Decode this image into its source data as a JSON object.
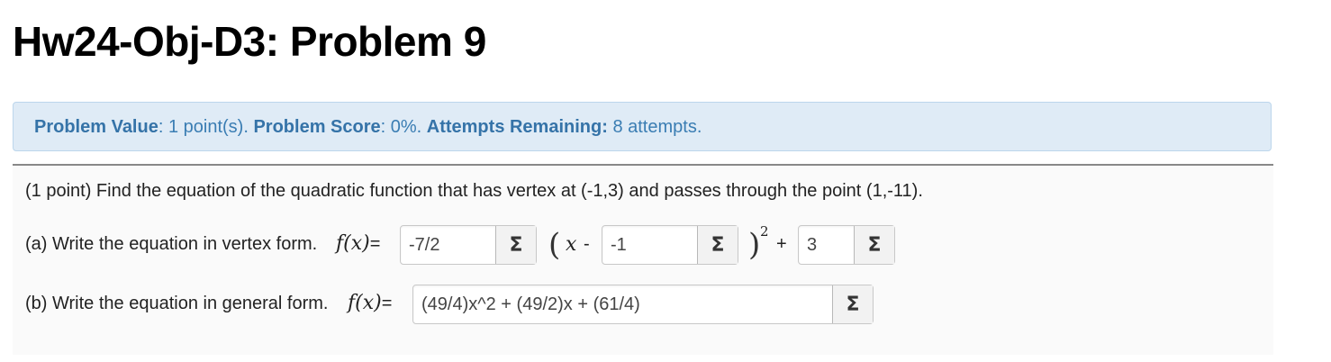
{
  "page": {
    "title": "Hw24-Obj-D3: Problem 9"
  },
  "info_bar": {
    "value_label": "Problem Value",
    "value_text": ": 1 point(s). ",
    "score_label": "Problem Score",
    "score_text": ": 0%. ",
    "attempts_label": "Attempts Remaining:",
    "attempts_text": " 8 attempts."
  },
  "problem": {
    "statement": "(1 point) Find the equation of the quadratic function that has vertex at (-1,3) and passes through the point (1,-11).",
    "part_a": {
      "label": "(a) Write the equation in vertex form.",
      "fx_f": "f",
      "fx_x": "(x)",
      "equals": "=",
      "answer_a": "-7/2",
      "open_paren": "(",
      "x_var": "x",
      "minus": "-",
      "answer_h": "-1",
      "close_paren": ")",
      "exponent": "2",
      "plus": "+",
      "answer_k": "3"
    },
    "part_b": {
      "label": "(b) Write the equation in general form.",
      "fx_f": "f",
      "fx_x": "(x)",
      "equals": "=",
      "answer": "(49/4)x^2 + (49/2)x + (61/4)"
    },
    "sigma_symbol": "Σ"
  }
}
